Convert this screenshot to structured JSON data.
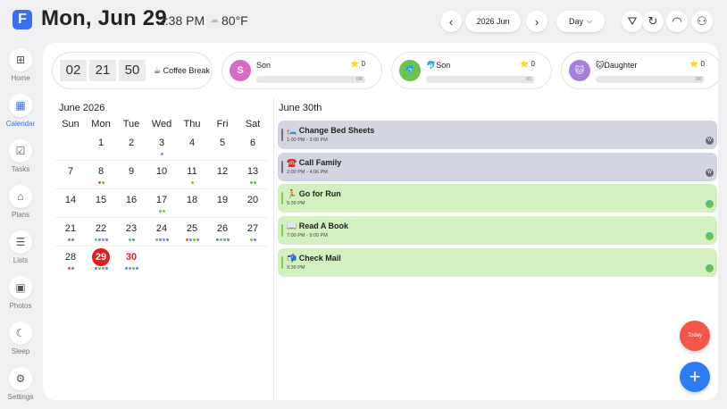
{
  "header": {
    "logo": "F",
    "date": "Mon, Jun 29",
    "time": "2:38 PM",
    "weather_icon": "☁",
    "temperature": "80°F",
    "month_label": "2026 Jun",
    "view_label": "Day",
    "view_chevron": "⌵",
    "prev_icon": "‹",
    "next_icon": "›",
    "filter_icon": "⛛",
    "refresh_icon": "↻",
    "wifi_icon": "◠",
    "profiles_icon": "⚇"
  },
  "sidebar": {
    "items": [
      {
        "label": "Home",
        "icon": "⊞"
      },
      {
        "label": "Calendar",
        "icon": "▦"
      },
      {
        "label": "Tasks",
        "icon": "☑"
      },
      {
        "label": "Plans",
        "icon": "⌂"
      },
      {
        "label": "Lists",
        "icon": "☰"
      },
      {
        "label": "Photos",
        "icon": "▣"
      },
      {
        "label": "Sleep",
        "icon": "☾"
      },
      {
        "label": "Settings",
        "icon": "⚙"
      }
    ],
    "active": "Calendar"
  },
  "countdown": {
    "hours": "02",
    "minutes": "21",
    "seconds": "50",
    "label": "☕ Coffee Break"
  },
  "members": [
    {
      "name": "Son",
      "avatar": "S",
      "avatar_color": "#d96bc4",
      "stars": "⭐ 0",
      "progress": "0/0",
      "progress_value": 0
    },
    {
      "name": "🐬Son",
      "avatar": "🐬",
      "avatar_color": "#6cc24a",
      "stars": "⭐ 0",
      "progress": "0/1",
      "progress_value": 0
    },
    {
      "name": "🐱Daughter",
      "avatar": "🐱",
      "avatar_color": "#a77fd8",
      "stars": "⭐ 0",
      "progress": "0/0",
      "progress_value": 0
    }
  ],
  "calendar": {
    "month_title": "June 2026",
    "weekdays": [
      "Sun",
      "Mon",
      "Tue",
      "Wed",
      "Thu",
      "Fri",
      "Sat"
    ],
    "weeks": [
      [
        {
          "d": ""
        },
        {
          "d": "1"
        },
        {
          "d": "2"
        },
        {
          "d": "3",
          "dots": [
            "#a77fd8"
          ]
        },
        {
          "d": "4"
        },
        {
          "d": "5"
        },
        {
          "d": "6"
        }
      ],
      [
        {
          "d": "7"
        },
        {
          "d": "8",
          "dots": [
            "#e25555",
            "#6cc24a"
          ]
        },
        {
          "d": "9"
        },
        {
          "d": "10"
        },
        {
          "d": "11",
          "dots": [
            "#6cc24a"
          ]
        },
        {
          "d": "12"
        },
        {
          "d": "13",
          "dots": [
            "#6cc24a",
            "#6cc24a"
          ]
        }
      ],
      [
        {
          "d": "14"
        },
        {
          "d": "15"
        },
        {
          "d": "16"
        },
        {
          "d": "17",
          "dots": [
            "#6cc24a",
            "#6cc24a"
          ]
        },
        {
          "d": "18"
        },
        {
          "d": "19"
        },
        {
          "d": "20"
        }
      ],
      [
        {
          "d": "21",
          "dots": [
            "#6b7de3",
            "#6b7de3"
          ]
        },
        {
          "d": "22",
          "dots": [
            "#6cc24a",
            "#6b7de3",
            "#a77fd8",
            "#6b7de3"
          ]
        },
        {
          "d": "23",
          "dots": [
            "#6cc24a",
            "#6b7de3"
          ]
        },
        {
          "d": "24",
          "dots": [
            "#6cc24a",
            "#6b7de3",
            "#a77fd8",
            "#6b7de3"
          ]
        },
        {
          "d": "25",
          "dots": [
            "#e25555",
            "#6b7de3",
            "#6cc24a",
            "#a77fd8"
          ]
        },
        {
          "d": "26",
          "dots": [
            "#6b7de3",
            "#6cc24a",
            "#a77fd8",
            "#6b7de3"
          ]
        },
        {
          "d": "27",
          "dots": [
            "#6cc24a",
            "#6b7de3"
          ]
        }
      ],
      [
        {
          "d": "28",
          "dots": [
            "#e25555",
            "#6b7de3"
          ]
        },
        {
          "d": "29",
          "today": true,
          "dots": [
            "#6b7de3",
            "#6cc24a",
            "#a77fd8",
            "#6b7de3"
          ]
        },
        {
          "d": "30",
          "red": true,
          "dots": [
            "#6b7de3",
            "#a77fd8",
            "#6cc24a",
            "#6b7de3"
          ]
        },
        {
          "d": ""
        },
        {
          "d": ""
        },
        {
          "d": ""
        },
        {
          "d": ""
        }
      ]
    ]
  },
  "day_view": {
    "title": "June  30th",
    "events": [
      {
        "title": "🛏️ Change Bed Sheets",
        "time": "1:00 PM - 3:00 PM",
        "bg": "#d4d5e2",
        "bar": "#6f6f80",
        "badge": "#6a6a78",
        "badge_text": "W"
      },
      {
        "title": "☎️ Call Family",
        "time": "2:00 PM - 4:06 PM",
        "bg": "#d4d5e2",
        "bar": "#6f6f80",
        "badge": "#6a6a78",
        "badge_text": "W"
      },
      {
        "title": "🏃 Go for Run",
        "time": "5:30 PM",
        "bg": "#d3f0c0",
        "bar": "#7fcb55",
        "badge": "#6cc24a",
        "badge_text": "🐬"
      },
      {
        "title": "📖 Read A Book",
        "time": "7:00 PM - 9:00 PM",
        "bg": "#d3f0c0",
        "bar": "#7fcb55",
        "badge": "#6cc24a",
        "badge_text": "🐬"
      },
      {
        "title": "📬 Check Mail",
        "time": "9:30 PM",
        "bg": "#d3f0c0",
        "bar": "#7fcb55",
        "badge": "#6cc24a",
        "badge_text": "🐬"
      }
    ]
  },
  "fabs": {
    "today_label": "Today",
    "add_label": "+"
  }
}
